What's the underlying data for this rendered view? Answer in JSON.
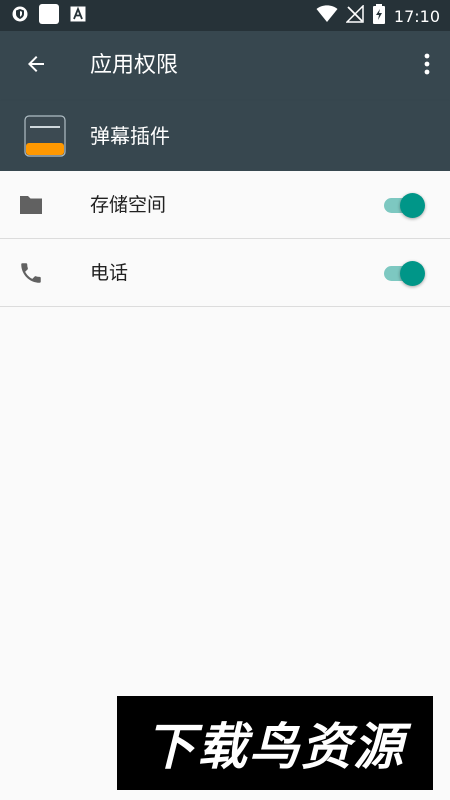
{
  "status_bar": {
    "time": "17:10",
    "left_icons": [
      "shield-icon",
      "white-square-icon",
      "font-a-icon"
    ],
    "right_icons": [
      "wifi-icon",
      "no-signal-icon",
      "battery-charging-icon"
    ]
  },
  "app_bar": {
    "title": "应用权限",
    "back_icon": "arrow-left-icon",
    "menu_icon": "more-vert-icon"
  },
  "app": {
    "name": "弹幕插件",
    "icon": "app-icon"
  },
  "permissions": [
    {
      "label": "存储空间",
      "icon": "folder-icon",
      "enabled": true
    },
    {
      "label": "电话",
      "icon": "phone-icon",
      "enabled": true
    }
  ],
  "watermark": {
    "text": "下载鸟资源"
  },
  "colors": {
    "status_bar": "#263238",
    "app_bar": "#37474f",
    "accent": "#009688",
    "background": "#fafafa",
    "app_icon_accent": "#ff9800"
  }
}
